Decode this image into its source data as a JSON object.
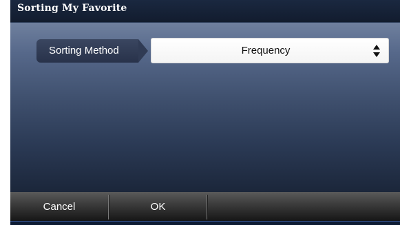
{
  "dialog": {
    "title": "Sorting My Favorite"
  },
  "sorting": {
    "label": "Sorting Method",
    "selected": "Frequency",
    "arrows_icon": "up-down-arrows-icon"
  },
  "footer": {
    "cancel_label": "Cancel",
    "ok_label": "OK"
  },
  "colors": {
    "title_bar": "#121c2e",
    "content_top": "#6f809e",
    "content_bottom": "#1b263a",
    "label_bg": "#303b54",
    "select_bg": "#ffffff",
    "footer_top": "#5a5a5a",
    "footer_bottom": "#161616"
  }
}
